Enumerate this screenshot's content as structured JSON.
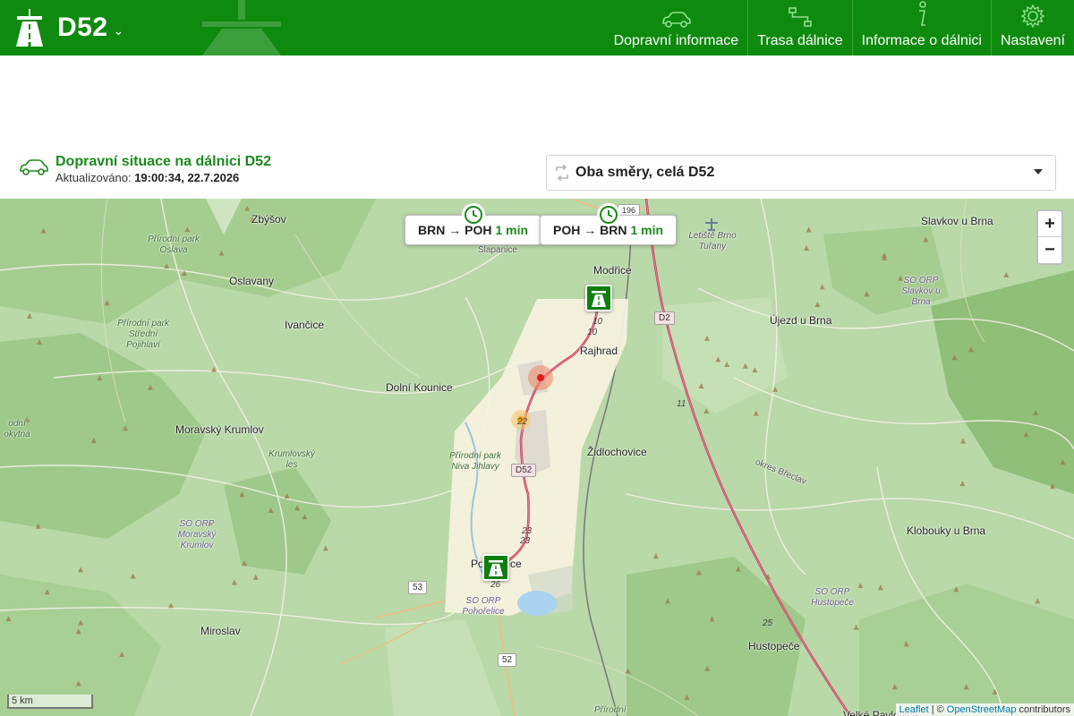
{
  "header": {
    "title": "D52",
    "nav": [
      {
        "label": "Dopravní informace",
        "icon": "car-icon"
      },
      {
        "label": "Trasa dálnice",
        "icon": "route-icon"
      },
      {
        "label": "Informace o dálnici",
        "icon": "info-icon"
      },
      {
        "label": "Nastavení",
        "icon": "gear-icon"
      }
    ]
  },
  "status": {
    "title": "Dopravní situace na dálnici D52",
    "updated_label": "Aktualizováno:",
    "updated_value": "19:00:34, 22.7.2026"
  },
  "direction_select": {
    "value": "Oba směry, celá D52"
  },
  "map": {
    "travel_times": [
      {
        "route": "BRN → POH",
        "time": "1 min"
      },
      {
        "route": "POH → BRN",
        "time": "1 min"
      }
    ],
    "places": {
      "zbysov": "Zbýšov",
      "oslavany": "Oslavany",
      "ivancice": "Ivančice",
      "dolni_kounice": "Dolní Kounice",
      "moravsky_krumlov": "Moravský Krumlov",
      "miroslav": "Miroslav",
      "modrice": "Modřice",
      "rajhrad": "Rajhrad",
      "zidlochovice": "Židlochovice",
      "pohorelice": "Pohořelice",
      "ujezd": "Újezd u Brna",
      "slavkov": "Slavkov u Brna",
      "klobouky": "Klobouky u Brna",
      "hustopece": "Hustopeče",
      "velke_pavlovice": "Velké Pavlovice",
      "slapanice": "Šlapanice",
      "airport": "Letiště Brno Tuřany",
      "okres": "okres Břeclav"
    },
    "parks": {
      "oslava": "Přírodní park Oslava",
      "pojihlavi": "Přírodní park Střední Pojihlaví",
      "rokytna": "odní okytná",
      "krumlovsky": "Krumlovský les",
      "niva": "Přírodní park Niva Jihlavy",
      "bottom": "Přírodní"
    },
    "orp": {
      "krumlov": "SO ORP Moravský Krumlov",
      "slavkov": "SO ORP Slavkov u Brna",
      "pohorelice": "SO ORP Pohořelice",
      "hustopece": "SO ORP Hustopeče"
    },
    "road_shields": {
      "d2": "D2",
      "d52": "D52",
      "r53": "53",
      "r52": "52",
      "r196": "196"
    },
    "km_markers": [
      "10",
      "10",
      "11",
      "22",
      "23",
      "23",
      "26",
      "25"
    ],
    "zoom_in": "+",
    "zoom_out": "−",
    "scale_label": "5 km",
    "attribution": {
      "leaflet": "Leaflet",
      "sep": "| ©",
      "osm": "OpenStreetMap",
      "tail": "contributors"
    }
  }
}
